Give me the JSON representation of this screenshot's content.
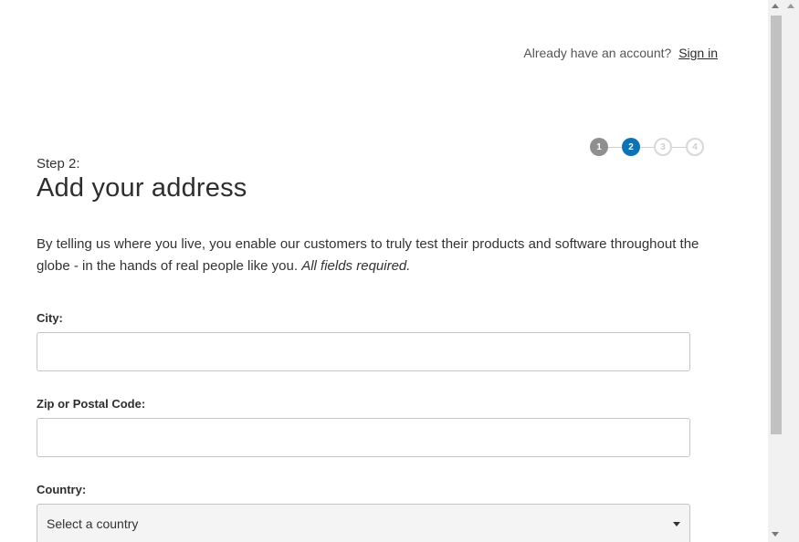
{
  "header": {
    "account_prompt": "Already have an account?",
    "signin_link": "Sign in"
  },
  "stepper": {
    "current_step": 2,
    "steps": [
      {
        "label": "1",
        "state": "done"
      },
      {
        "label": "2",
        "state": "current"
      },
      {
        "label": "3",
        "state": "todo"
      },
      {
        "label": "4",
        "state": "todo"
      }
    ]
  },
  "main": {
    "step_label": "Step 2:",
    "title": "Add your address",
    "intro": "By telling us where you live, you enable our customers to truly test their products and software throughout the globe - in the hands of real people like you.",
    "intro_emphasis": "All fields required."
  },
  "form": {
    "city": {
      "label": "City:",
      "value": ""
    },
    "zip": {
      "label": "Zip or Postal Code:",
      "value": ""
    },
    "country": {
      "label": "Country:",
      "selected": "Select a country"
    }
  },
  "colors": {
    "accent": "#0f72b5",
    "step_done": "#8f8f8f",
    "step_todo_border": "#d8d8d8"
  }
}
